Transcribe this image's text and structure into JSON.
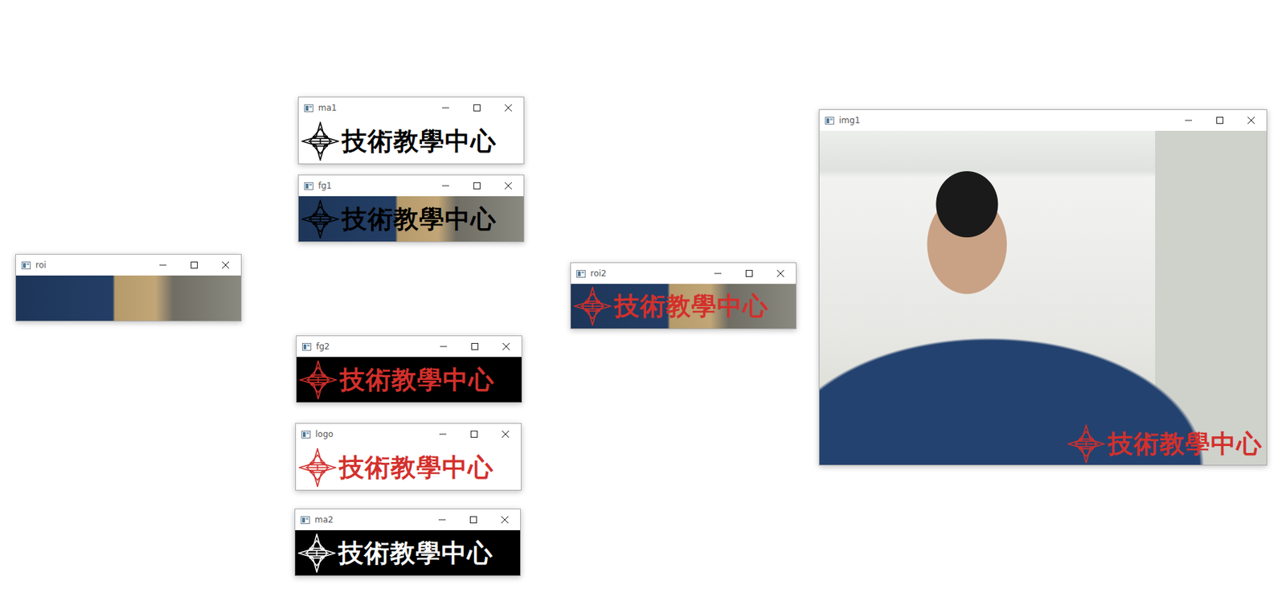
{
  "desktop": {
    "windows": [
      {
        "title": "roi",
        "kind": "crop",
        "logo": null
      },
      {
        "title": "ma1",
        "kind": "logo",
        "logo": {
          "text": "技術教學中心",
          "color": "#000000",
          "ground": "white"
        }
      },
      {
        "title": "fg1",
        "kind": "logo",
        "logo": {
          "text": "技術教學中心",
          "color": "#000000",
          "ground": "photo"
        }
      },
      {
        "title": "roi2",
        "kind": "logo",
        "logo": {
          "text": "技術教學中心",
          "color": "#d3302c",
          "ground": "photo"
        }
      },
      {
        "title": "fg2",
        "kind": "logo",
        "logo": {
          "text": "技術教學中心",
          "color": "#d3302c",
          "ground": "black"
        }
      },
      {
        "title": "logo",
        "kind": "logo",
        "logo": {
          "text": "技術教學中心",
          "color": "#d3302c",
          "ground": "white"
        }
      },
      {
        "title": "ma2",
        "kind": "logo",
        "logo": {
          "text": "技術教學中心",
          "color": "#ffffff",
          "ground": "black"
        }
      },
      {
        "title": "img1",
        "kind": "camera",
        "logo": {
          "text": "技術教學中心",
          "color": "#d3302c",
          "ground": "none"
        }
      }
    ]
  }
}
